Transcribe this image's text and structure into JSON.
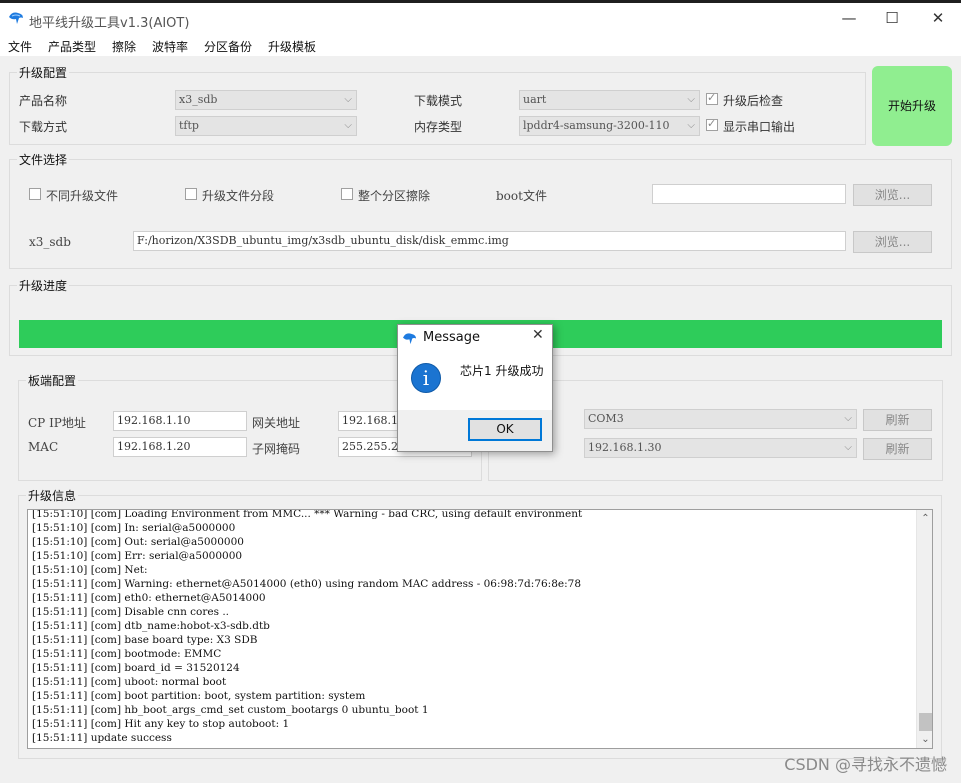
{
  "window": {
    "title": "地平线升级工具v1.3(AIOT)",
    "minimize": "—",
    "maximize": "☐",
    "close": "✕",
    "icon": "bird-app-icon"
  },
  "menu": [
    "文件",
    "产品类型",
    "擦除",
    "波特率",
    "分区备份",
    "升级模板"
  ],
  "upgrade_config": {
    "title": "升级配置",
    "product_name_label": "产品名称",
    "product_name_value": "x3_sdb",
    "download_method_label": "下载方式",
    "download_method_value": "tftp",
    "download_mode_label": "下载模式",
    "download_mode_value": "uart",
    "memory_type_label": "内存类型",
    "memory_type_value": "lpddr4-samsung-3200-110",
    "check_after_label": "升级后检查",
    "check_after_checked": true,
    "show_serial_label": "显示串口输出",
    "show_serial_checked": true
  },
  "start_button": "开始升级",
  "file_select": {
    "title": "文件选择",
    "diff_files_label": "不同升级文件",
    "segment_label": "升级文件分段",
    "whole_erase_label": "整个分区擦除",
    "boot_file_label": "boot文件",
    "boot_file_value": "",
    "browse": "浏览...",
    "image_label": "x3_sdb",
    "image_path": "F:/horizon/X3SDB_ubuntu_img/x3sdb_ubuntu_disk/disk_emmc.img"
  },
  "progress": {
    "title": "升级进度",
    "fraction": 1.0,
    "color": "#2ecc5a"
  },
  "board_config": {
    "title": "板端配置",
    "cp_ip_label": "CP IP地址",
    "cp_ip_value": "192.168.1.10",
    "gateway_label": "网关地址",
    "gateway_value": "192.168.1",
    "mac_label": "MAC",
    "mac_value": "192.168.1.20",
    "subnet_label": "子网掩码",
    "subnet_value": "255.255.2",
    "com_value": "COM3",
    "host_ip_value": "192.168.1.30",
    "refresh": "刷新"
  },
  "log": {
    "title": "升级信息",
    "lines": [
      "[15:51:10] [com] Loading Environment from MMC... *** Warning - bad CRC, using default environment",
      "[15:51:10] [com] In:    serial@a5000000",
      "[15:51:10] [com] Out:   serial@a5000000",
      "[15:51:10] [com] Err:   serial@a5000000",
      "[15:51:10] [com] Net:",
      "[15:51:11] [com] Warning: ethernet@A5014000 (eth0) using random MAC address - 06:98:7d:76:8e:78",
      "[15:51:11] [com] eth0: ethernet@A5014000",
      "[15:51:11] [com] Disable cnn cores ..",
      "[15:51:11] [com] dtb_name:hobot-x3-sdb.dtb",
      "[15:51:11] [com] base board type: X3 SDB",
      "[15:51:11] [com] bootmode: EMMC",
      "[15:51:11] [com] board_id = 31520124",
      "[15:51:11] [com] uboot: normal boot",
      "[15:51:11] [com] boot partition: boot, system partition: system",
      "[15:51:11] [com] hb_boot_args_cmd_set custom_bootargs 0 ubuntu_boot 1",
      "[15:51:11] [com] Hit any key to stop autoboot:  1",
      "[15:51:11] update success"
    ]
  },
  "dialog": {
    "title": "Message",
    "close": "✕",
    "icon": "information-icon",
    "icon_glyph": "i",
    "message": "芯片1 升级成功",
    "ok": "OK"
  },
  "watermark": "CSDN @寻找永不遗憾"
}
